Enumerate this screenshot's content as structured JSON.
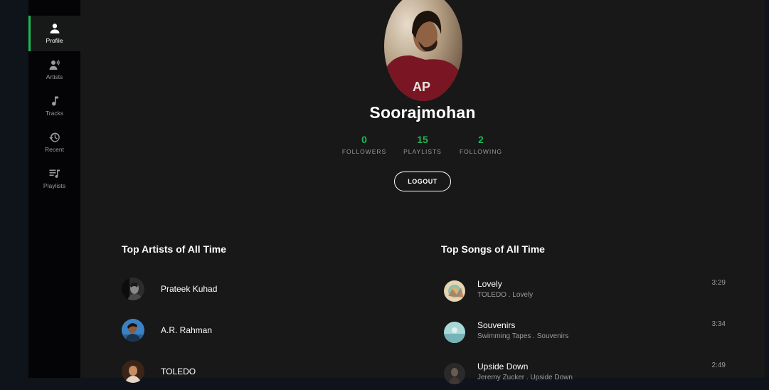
{
  "sidebar": {
    "items": [
      {
        "label": "Profile",
        "icon": "user-icon",
        "active": true
      },
      {
        "label": "Artists",
        "icon": "microphone-icon",
        "active": false
      },
      {
        "label": "Tracks",
        "icon": "music-note-icon",
        "active": false
      },
      {
        "label": "Recent",
        "icon": "history-icon",
        "active": false
      },
      {
        "label": "Playlists",
        "icon": "playlist-icon",
        "active": false
      }
    ]
  },
  "profile": {
    "username": "Soorajmohan",
    "stats": [
      {
        "value": "0",
        "caption": "FOLLOWERS"
      },
      {
        "value": "15",
        "caption": "PLAYLISTS"
      },
      {
        "value": "2",
        "caption": "FOLLOWING"
      }
    ],
    "logout_label": "LOGOUT"
  },
  "top_artists": {
    "title": "Top Artists of All Time",
    "items": [
      {
        "name": "Prateek Kuhad"
      },
      {
        "name": "A.R. Rahman"
      },
      {
        "name": "TOLEDO"
      }
    ]
  },
  "top_songs": {
    "title": "Top Songs of All Time",
    "items": [
      {
        "title": "Lovely",
        "meta": "TOLEDO . Lovely",
        "duration": "3:29"
      },
      {
        "title": "Souvenirs",
        "meta": "Swimming Tapes . Souvenirs",
        "duration": "3:34"
      },
      {
        "title": "Upside Down",
        "meta": "Jeremy Zucker . Upside Down",
        "duration": "2:49"
      }
    ]
  },
  "colors": {
    "accent": "#1db954",
    "background": "#181818",
    "sidebar": "#040306",
    "muted": "#9b9b9b"
  }
}
